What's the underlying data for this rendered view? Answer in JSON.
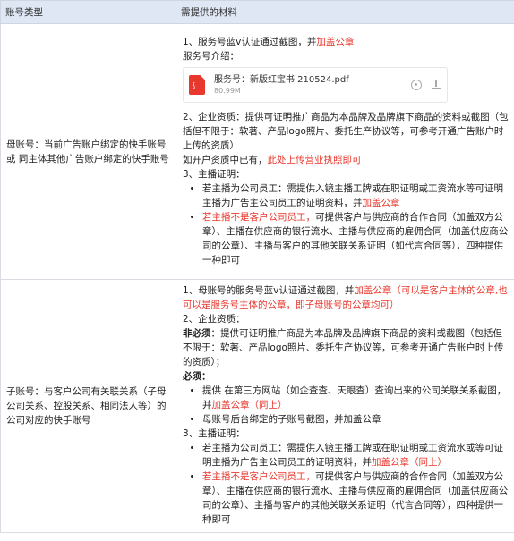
{
  "header": {
    "col1": "账号类型",
    "col2": "需提供的材料"
  },
  "row1": {
    "left": "母账号：当前广告账户绑定的快手账号或 同主体其他广告账户绑定的快手账号",
    "item1_a": "1、服务号蓝v认证通过截图，并",
    "item1_red": "加盖公章",
    "intro": "服务号介绍：",
    "file": {
      "name": "服务号：新版红宝书 210524.pdf",
      "size": "80.99M",
      "icon": "pdf-icon"
    },
    "item2": "2、企业资质：提供可证明推广商品为本品牌及品牌旗下商品的资料或截图（包括但不限于：软著、产品logo照片、委托生产协议等，可参考开通广告账户时上传的资质）",
    "item2_b": "如开户资质中已有，",
    "item2_red": "此处上传营业执照即可",
    "item3": "3、主播证明：",
    "b1_a": "若主播为公司员工：需提供入镜主播工牌或在职证明或工资流水等可证明主播为广告主公司员工的证明资料，并",
    "b1_red": "加盖公章",
    "b2_red": "若主播不是客户公司员工，",
    "b2_b": "可提供客户与供应商的合作合同（加盖双方公章）、主播在供应商的银行流水、主播与供应商的雇佣合同（加盖供应商公司的公章）、主播与客户的其他关联关系证明（如代言合同等），四种提供一种即可"
  },
  "row2": {
    "left": "子账号：与客户公司有关联关系（子母公司关系、控股关系、相同法人等）的公司对应的快手账号",
    "item1_a": "1、母账号的服务号蓝v认证通过截图，并",
    "item1_red": "加盖公章（可以是客户主体的公章,也可以是服务号主体的公章，即子母账号的公章均可）",
    "item2": "2、企业资质：",
    "nb_label": "非必须",
    "nb_text": "：提供可证明推广商品为本品牌及品牌旗下商品的资料或截图（包括但不限于：软著、产品logo照片、委托生产协议等，可参考开通广告账户时上传的资质）；",
    "req_label": "必须：",
    "c1_a": "提供 在第三方网站（如企查查、天眼查）查询出来的公司关联关系截图，并",
    "c1_red": "加盖公章（同上）",
    "c2": "母账号后台绑定的子账号截图，并加盖公章",
    "item3": "3、主播证明：",
    "d1_a": "若主播为公司员工：需提供入镜主播工牌或在职证明或工资流水或等可证明主播为广告主公司员工的证明资料，并",
    "d1_red": "加盖公章（同上）",
    "d2_red": "若主播不是客户公司员工，",
    "d2_b": "可提供客户与供应商的合作合同（加盖双方公章）、主播在供应商的银行流水、主播与供应商的雇佣合同（加盖供应商公司的公章）、主播与客户的其他关联关系证明（代言合同等），四种提供一种即可"
  }
}
